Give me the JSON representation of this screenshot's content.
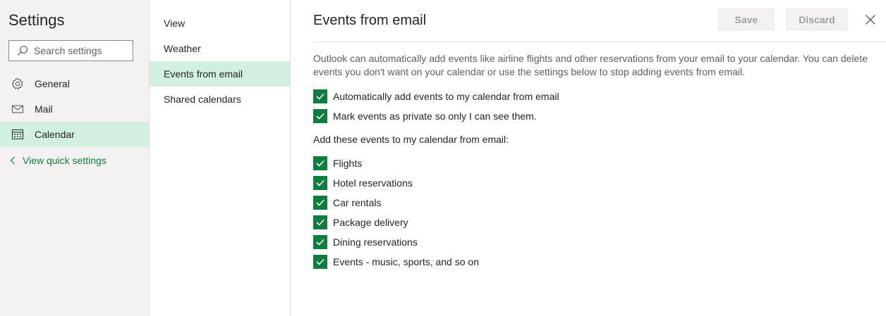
{
  "app_title": "Settings",
  "search": {
    "placeholder": "Search settings"
  },
  "nav": [
    {
      "label": "General",
      "icon": "gear-icon"
    },
    {
      "label": "Mail",
      "icon": "mail-icon"
    },
    {
      "label": "Calendar",
      "icon": "calendar-icon",
      "selected": true
    }
  ],
  "quick_settings_label": "View quick settings",
  "subnav": [
    {
      "label": "View"
    },
    {
      "label": "Weather"
    },
    {
      "label": "Events from email",
      "selected": true
    },
    {
      "label": "Shared calendars"
    }
  ],
  "main": {
    "title": "Events from email",
    "save_label": "Save",
    "discard_label": "Discard",
    "description": "Outlook can automatically add events like airline flights and other reservations from your email to your calendar. You can delete events you don't want on your calendar or use the settings below to stop adding events from email.",
    "options": [
      {
        "label": "Automatically add events to my calendar from email",
        "checked": true
      },
      {
        "label": "Mark events as private so only I can see them.",
        "checked": true
      }
    ],
    "section_label": "Add these events to my calendar from email:",
    "event_types": [
      {
        "label": "Flights",
        "checked": true
      },
      {
        "label": "Hotel reservations",
        "checked": true
      },
      {
        "label": "Car rentals",
        "checked": true
      },
      {
        "label": "Package delivery",
        "checked": true
      },
      {
        "label": "Dining reservations",
        "checked": true
      },
      {
        "label": "Events - music, sports, and so on",
        "checked": true
      }
    ]
  },
  "colors": {
    "accent": "#107c41",
    "selected_bg": "#d1f0df",
    "sidebar_bg": "#f3f2f1"
  }
}
